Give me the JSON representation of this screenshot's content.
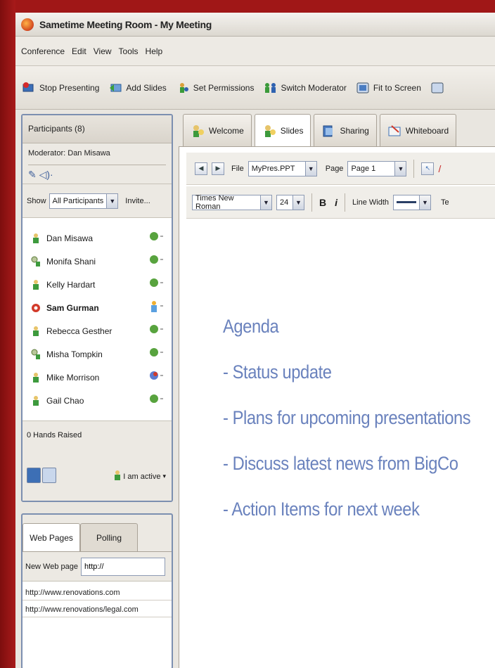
{
  "window": {
    "title": "Sametime Meeting Room - My Meeting"
  },
  "menu": [
    "Conference",
    "Edit",
    "View",
    "Tools",
    "Help"
  ],
  "toolbar": {
    "stop_presenting": "Stop Presenting",
    "add_slides": "Add Slides",
    "set_permissions": "Set Permissions",
    "switch_moderator": "Switch Moderator",
    "fit_to_screen": "Fit to Screen"
  },
  "participants": {
    "header": "Participants (8)",
    "moderator": "Moderator: Dan Misawa",
    "show_label": "Show",
    "show_value": "All Participants",
    "invite": "Invite...",
    "people": [
      {
        "name": "Dan Misawa"
      },
      {
        "name": "Monifa Shani"
      },
      {
        "name": "Kelly Hardart"
      },
      {
        "name": "Sam Gurman"
      },
      {
        "name": "Rebecca Gesther"
      },
      {
        "name": "Misha Tompkin"
      },
      {
        "name": "Mike Morrison"
      },
      {
        "name": "Gail Chao"
      }
    ],
    "hands_raised": "0 Hands Raised",
    "active_status": "I am active"
  },
  "web": {
    "tabs": [
      "Web Pages",
      "Polling"
    ],
    "new_label": "New Web page",
    "input_value": "http://",
    "links": [
      "http://www.renovations.com",
      "http://www.renovations/legal.com"
    ]
  },
  "main_tabs": [
    "Welcome",
    "Slides",
    "Sharing",
    "Whiteboard"
  ],
  "slides_toolbar": {
    "file_label": "File",
    "file_value": "MyPres.PPT",
    "page_label": "Page",
    "page_value": "Page 1"
  },
  "format_toolbar": {
    "font": "Times New Roman",
    "size": "24",
    "bold": "B",
    "italic": "i",
    "line_width_label": "Line Width",
    "text_label": "Te"
  },
  "slide": {
    "title": "Agenda",
    "items": [
      "- Status update",
      "- Plans for upcoming presentations",
      "- Discuss latest news from BigCo",
      "- Action Items for next week"
    ]
  }
}
